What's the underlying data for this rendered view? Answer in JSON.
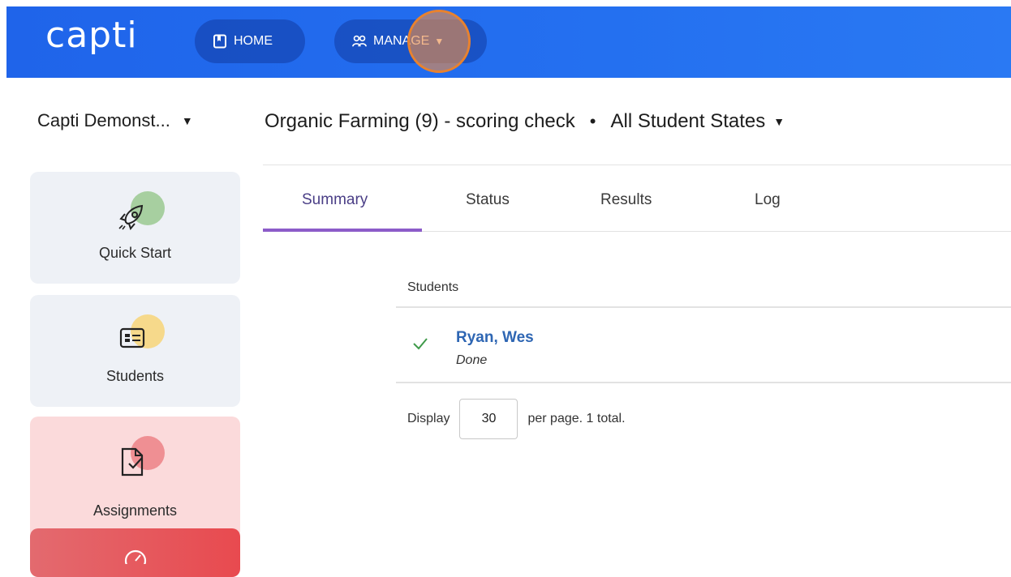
{
  "app": {
    "logo_text": "capti",
    "nav": {
      "home_label": "HOME",
      "manage_label": "MANAGE"
    }
  },
  "sidebar": {
    "org_name": "Capti Demonst...",
    "items": [
      {
        "label": "Quick Start",
        "icon": "rocket-icon",
        "accent": "#a7cfa0"
      },
      {
        "label": "Students",
        "icon": "id-card-icon",
        "accent": "#f6d98b"
      },
      {
        "label": "Assignments",
        "icon": "assignment-icon",
        "accent": "#ef8f93"
      }
    ]
  },
  "header": {
    "assignment": "Organic Farming (9) - scoring check",
    "separator": "•",
    "filter": "All Student States"
  },
  "tabs": [
    {
      "label": "Summary",
      "active": true
    },
    {
      "label": "Status",
      "active": false
    },
    {
      "label": "Results",
      "active": false
    },
    {
      "label": "Log",
      "active": false
    }
  ],
  "table": {
    "column_header": "Students",
    "rows": [
      {
        "name": "Ryan, Wes",
        "state": "Done",
        "status_icon": "check-icon"
      }
    ]
  },
  "pager": {
    "prefix": "Display",
    "page_size": "30",
    "suffix": "per page. 1 total."
  },
  "colors": {
    "topbar": "#1f64ea",
    "active_tab_underline": "#8c5cc9",
    "link": "#2e66b3",
    "check": "#3f9a4a"
  }
}
